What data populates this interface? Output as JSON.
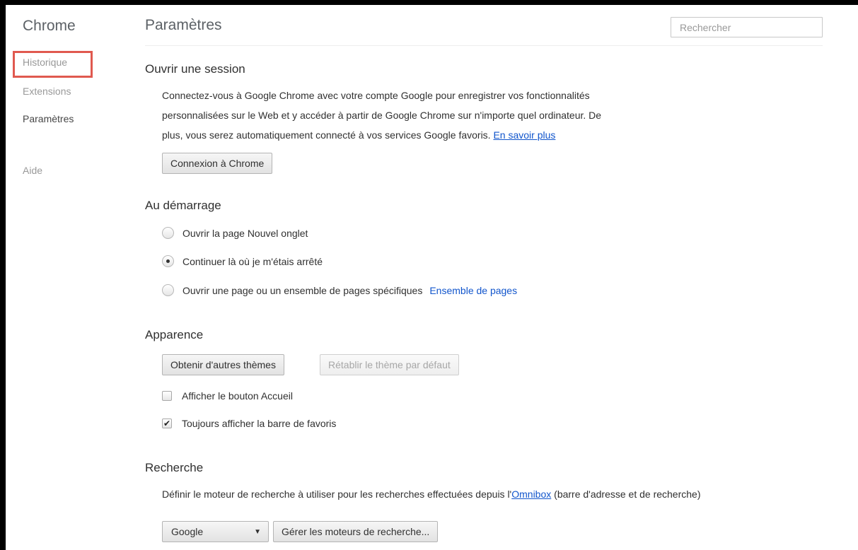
{
  "sidebar": {
    "title": "Chrome",
    "items": [
      {
        "label": "Historique"
      },
      {
        "label": "Extensions"
      },
      {
        "label": "Paramètres"
      },
      {
        "label": "Aide"
      }
    ]
  },
  "header": {
    "title": "Paramètres",
    "search_placeholder": "Rechercher"
  },
  "signin": {
    "title": "Ouvrir une session",
    "line1": "Connectez-vous à Google Chrome avec votre compte Google pour enregistrer vos fonctionnalités",
    "line2": "personnalisées sur le Web et y accéder à partir de Google Chrome sur n'importe quel ordinateur. De",
    "line3": "plus, vous serez automatiquement connecté à vos services Google favoris.",
    "learn_more": "En savoir plus",
    "button": "Connexion à Chrome"
  },
  "startup": {
    "title": "Au démarrage",
    "options": [
      {
        "label": "Ouvrir la page Nouvel onglet",
        "checked": false
      },
      {
        "label": "Continuer là où je m'étais arrêté",
        "checked": true
      },
      {
        "label": "Ouvrir une page ou un ensemble de pages spécifiques",
        "checked": false
      }
    ],
    "pages_link": "Ensemble de pages"
  },
  "appearance": {
    "title": "Apparence",
    "get_themes": "Obtenir d'autres thèmes",
    "reset_theme": "Rétablir le thème par défaut",
    "show_home": {
      "label": "Afficher le bouton Accueil",
      "checked": false
    },
    "show_bookmarks": {
      "label": "Toujours afficher la barre de favoris",
      "checked": true
    }
  },
  "search": {
    "title": "Recherche",
    "desc_before": "Définir le moteur de recherche à utiliser pour les recherches effectuées depuis l'",
    "omnibox_link": "Omnibox",
    "desc_after": " (barre d'adresse et de recherche)",
    "engine": "Google",
    "manage_button": "Gérer les moteurs de recherche..."
  },
  "colors": {
    "highlight": "#e0594f",
    "link": "#1155cc"
  }
}
